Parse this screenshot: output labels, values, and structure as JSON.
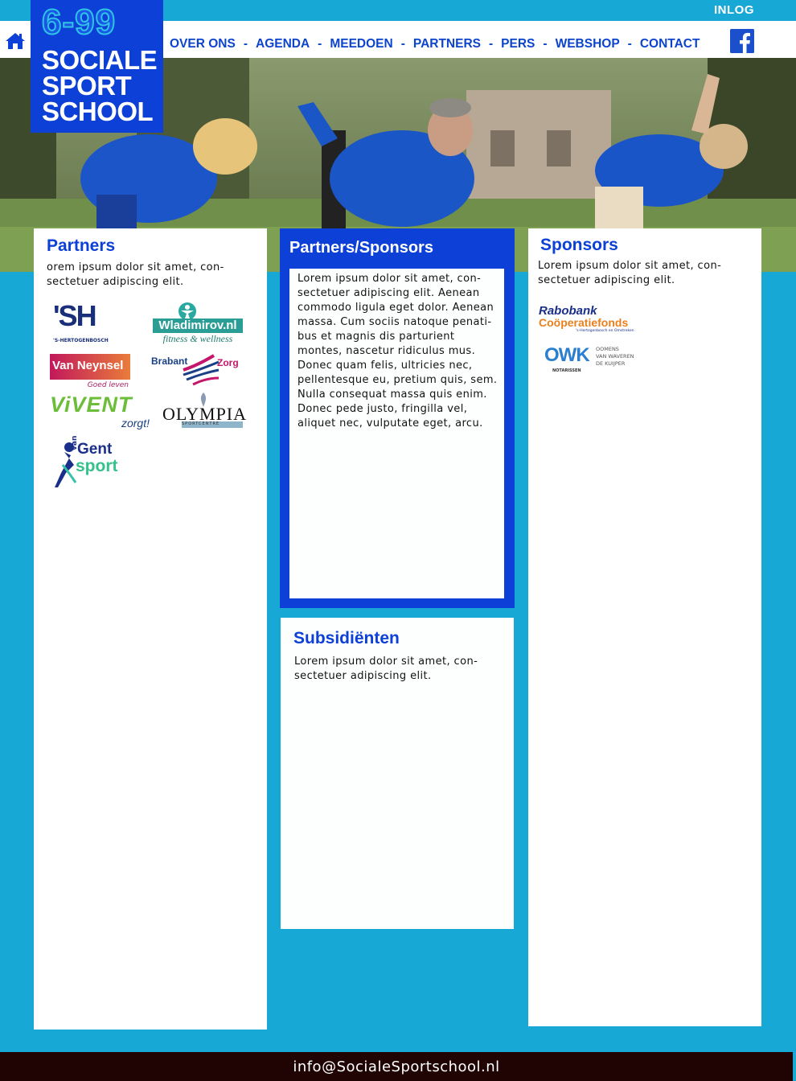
{
  "header": {
    "inlog": "INLOG",
    "nav": [
      "OVER ONS",
      "AGENDA",
      "MEEDOEN",
      "PARTNERS",
      "PERS",
      "WEBSHOP",
      "CONTACT"
    ],
    "separator": "-"
  },
  "logo": {
    "number": "6-99",
    "line1": "SOCIALE",
    "line2": "SPORT",
    "line3": "SCHOOL"
  },
  "partners": {
    "title": "Partners",
    "text": "orem ipsum dolor sit amet, con-sectetuer adipiscing elit.",
    "logos": {
      "sh_mark": "'SH",
      "sh_caption": "'S-HERTOGENBOSCH",
      "wladimirov": "Wladimirov.nl",
      "wladimirov_tag": "fitness & wellness",
      "vanneynsel": "Van Neynsel",
      "vanneynsel_tag": "Goed leven",
      "brabant": "Brabant",
      "zorg": "Zorg",
      "vivent": "ViVENT",
      "vivent_tag": "zorgt!",
      "olympia": "OLYMPIA",
      "olympia_tag": "SPORTCENTRE",
      "vangent_van": "van",
      "vangent_gent": "Gent",
      "vangent_sport": "sport"
    }
  },
  "partners_sponsors": {
    "title": "Partners/Sponsors",
    "text": "Lorem ipsum dolor sit amet, con-sectetuer adipiscing elit. Aenean commodo ligula eget dolor. Aenean massa. Cum sociis natoque penati-bus et magnis dis parturient montes, nascetur ridiculus mus. Donec quam felis, ultricies nec, pellentesque eu, pretium quis, sem. Nulla consequat massa quis enim. Donec pede justo, fringilla vel, aliquet nec, vulputate eget, arcu."
  },
  "subsidienten": {
    "title": "Subsidiënten",
    "text": "Lorem ipsum dolor sit amet, con-sectetuer adipiscing elit."
  },
  "sponsors": {
    "title": "Sponsors",
    "text": "Lorem ipsum dolor sit amet, con-sectetuer adipiscing elit.",
    "logos": {
      "rabobank": "Rabobank",
      "cooperatiefonds": "Coöperatiefonds",
      "rabobank_caption": "'s-Hertogenbosch en Omstreken",
      "owk_mark": "OWK",
      "owk_caption": "NOTARISSEN",
      "owk_l1": "OOMENS",
      "owk_l2": "VAN WAVEREN",
      "owk_l3": "DE KUIJPER"
    }
  },
  "footer": {
    "email": "info@SocialeSportschool.nl"
  },
  "colors": {
    "background": "#17a8d5",
    "brand_blue": "#0d40d6",
    "footer": "#200404"
  }
}
